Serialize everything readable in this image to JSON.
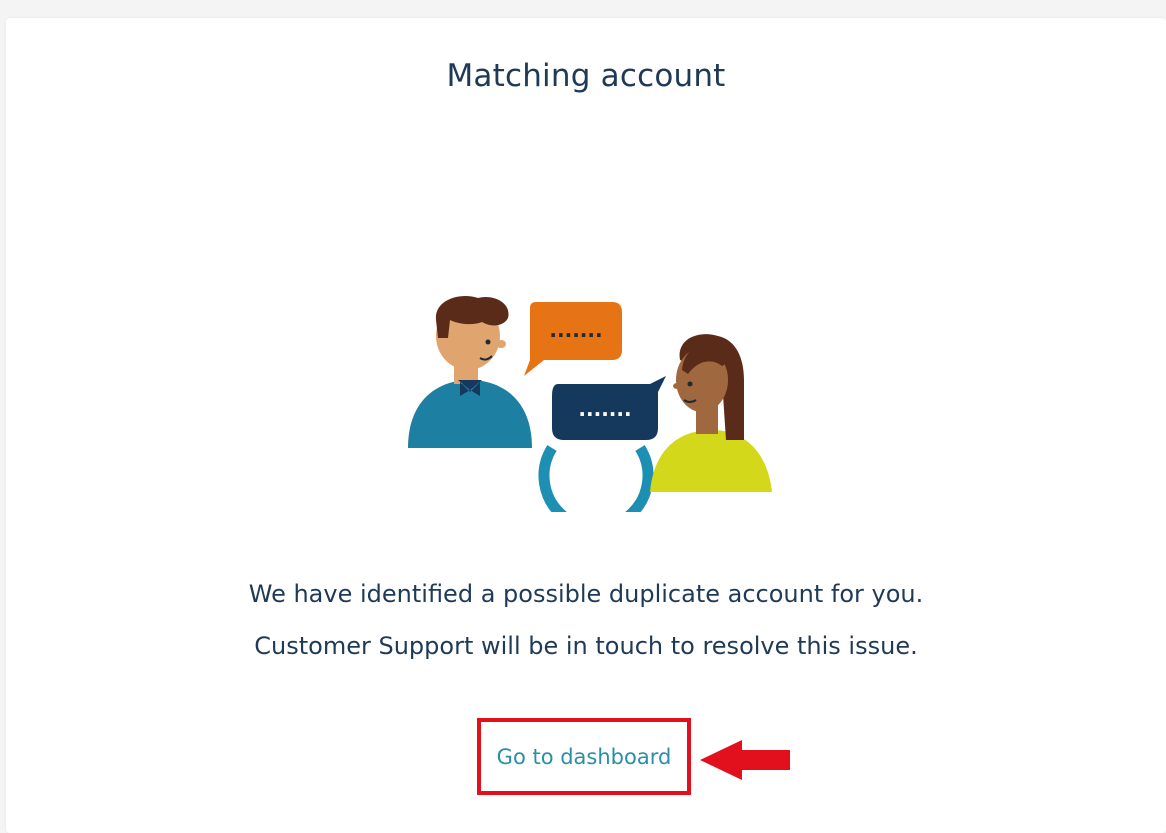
{
  "page": {
    "title": "Matching account",
    "message_line1": "We have identified a possible duplicate account for you.",
    "message_line2": "Customer Support will be in touch to resolve this issue.",
    "dashboard_link": "Go to dashboard"
  },
  "illustration": {
    "bubble_left_text": ".......",
    "bubble_right_text": "......."
  },
  "colors": {
    "title": "#1f3a57",
    "link": "#2a8fa6",
    "highlight": "#e2101d",
    "man_shirt": "#1d7fa2",
    "woman_shirt": "#d3d81a",
    "bubble_orange": "#e67314",
    "bubble_navy": "#14395c",
    "circle": "#1d8fb3"
  }
}
